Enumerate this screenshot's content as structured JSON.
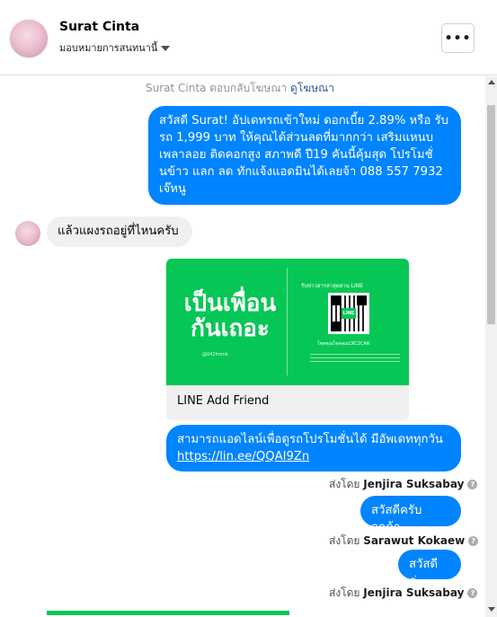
{
  "header": {
    "page_name": "Surat Cinta",
    "assign_label": "มอบหมายการสนทนานี้",
    "more_label": "•••"
  },
  "thread": {
    "ad_reply_text": "Surat Cinta ตอบกลับโฆษณา",
    "ad_reply_link": "ดูโฆษณา",
    "messages": [
      {
        "direction": "outgoing",
        "text": "สวัสดี Surat! อัปเดทรถเข้าใหม่ ดอกเบี้ย 2.89% หรือ รับรถ 1,999 บาท ให้คุณได้ส่วนลดที่มากกว่า เสริมแหนบ เพลาลอย ติดคอกสูง สภาพดี ปี19 คันนี้คุ้มสุด โปรโมชั่นข้าว แลก ลด ทักแจ้งแอดมินได้เลยจ้า 088 557 7932 เจ๊หนู"
      },
      {
        "direction": "incoming",
        "text": "แล้วแผงรถอยู่ที่ไหนครับ"
      },
      {
        "direction": "outgoing",
        "type": "card",
        "card": {
          "headline": "เป็นเพื่อนกันเถอะ",
          "small_id": "@042fmmk",
          "right_title": "รับข่าวสารล่าสุดผ่าน LINE",
          "qr_logo": "LINE",
          "right_code": "โชคคุณโชคคุณCKC2CAR",
          "title": "LINE Add Friend"
        }
      },
      {
        "direction": "outgoing",
        "text": "สามารถแอดไลน์เพื่อดูรถโปรโมชั่นได้ มีอัพเดททุกวัน",
        "link": "https://lin.ee/QQAI9Zn"
      },
      {
        "direction": "sent_by",
        "prefix": "ส่งโดย",
        "name": "Jenjira Suksabay",
        "help_icon": "?"
      },
      {
        "direction": "outgoing",
        "text": "สวัสดีครับลูกค้า"
      },
      {
        "direction": "sent_by",
        "prefix": "ส่งโดย",
        "name": "Sarawut Kokaew",
        "help_icon": "?"
      },
      {
        "direction": "outgoing",
        "text": "สวัสดีค่ะ"
      },
      {
        "direction": "sent_by",
        "prefix": "ส่งโดย",
        "name": "Jenjira Suksabay",
        "help_icon": "?"
      }
    ]
  },
  "colors": {
    "outgoing_bubble": "#0084ff",
    "incoming_bubble": "#f1f0f0",
    "line_green": "#06c755",
    "link_blue": "#385898"
  },
  "icons": {
    "caret": "caret-down-icon",
    "help": "question-circle-icon",
    "more": "more-horizontal-icon"
  }
}
